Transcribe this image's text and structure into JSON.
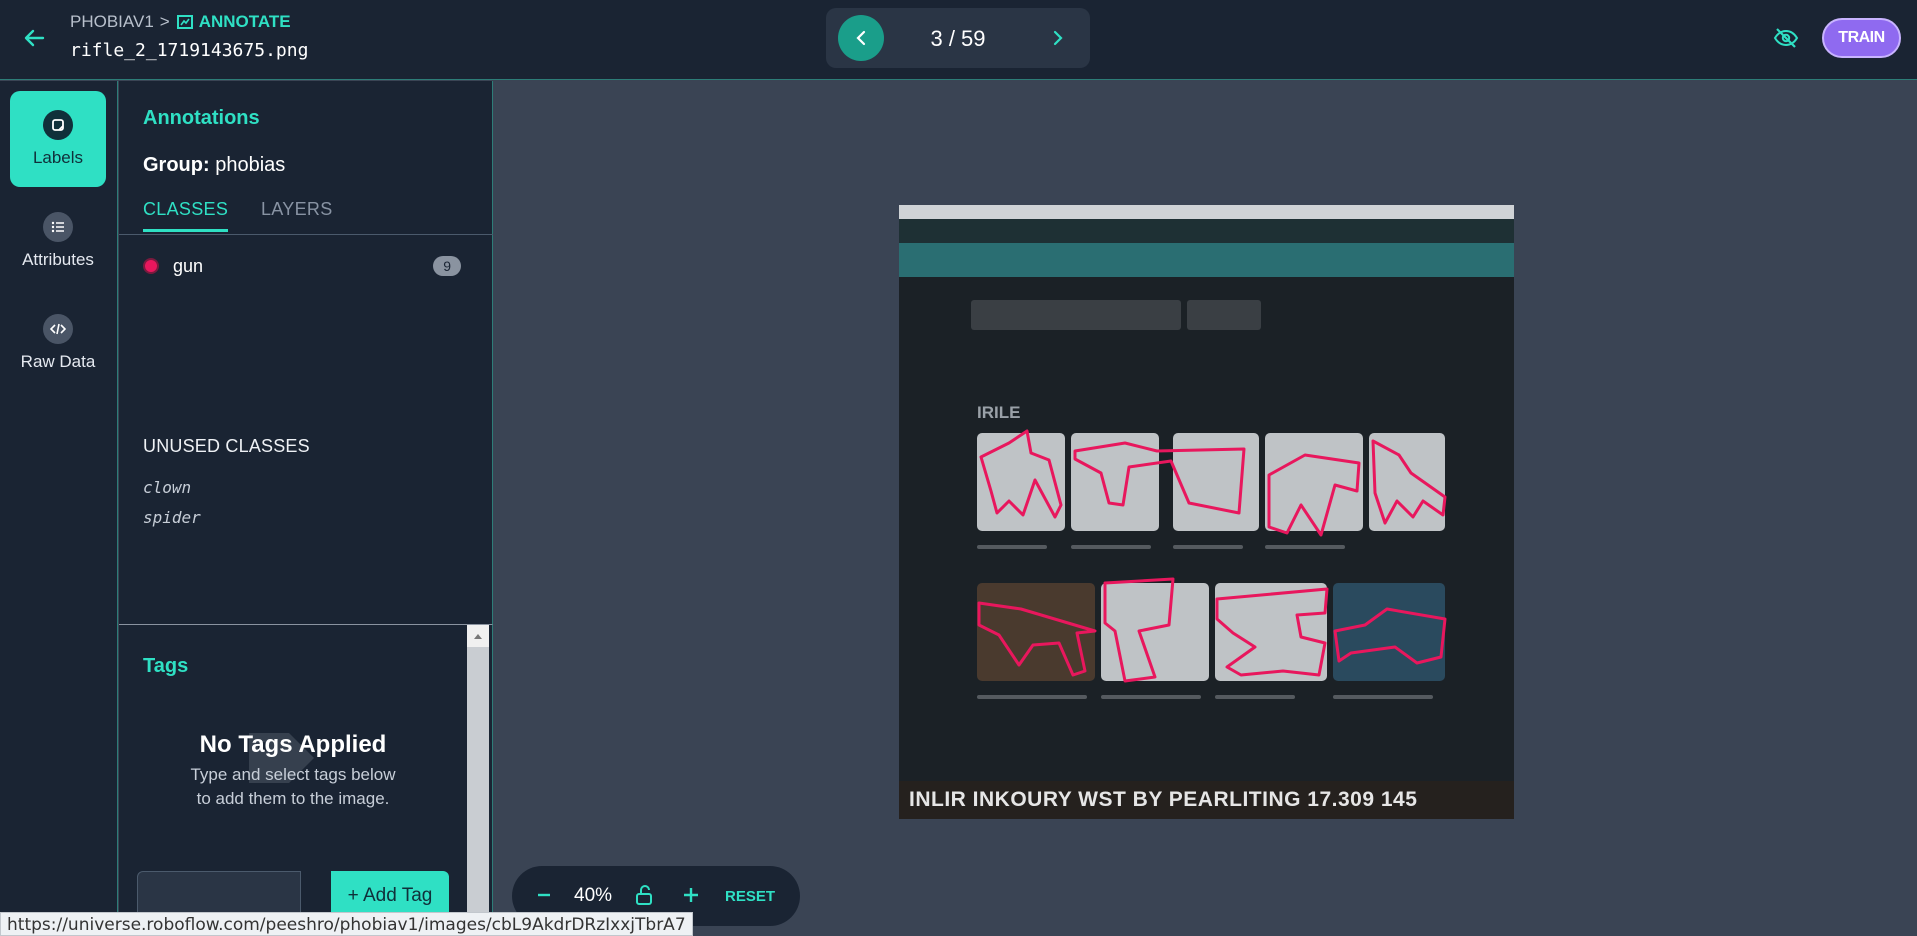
{
  "header": {
    "breadcrumb_project": "PHOBIAV1",
    "breadcrumb_separator": ">",
    "breadcrumb_section": "ANNOTATE",
    "filename": "rifle_2_1719143675.png",
    "pager": {
      "current_label": "3 / 59"
    },
    "train_label": "TRAIN"
  },
  "rail": {
    "items": [
      {
        "label": "Labels",
        "icon": "label-icon",
        "active": true
      },
      {
        "label": "Attributes",
        "icon": "list-icon",
        "active": false
      },
      {
        "label": "Raw Data",
        "icon": "code-icon",
        "active": false
      }
    ]
  },
  "annotations": {
    "title": "Annotations",
    "group_label": "Group:",
    "group_value": "phobias",
    "tabs": [
      "CLASSES",
      "LAYERS"
    ],
    "classes": [
      {
        "name": "gun",
        "count": "9",
        "color": "#e8175d"
      }
    ],
    "unused_title": "UNUSED CLASSES",
    "unused": [
      "clown",
      "spider"
    ]
  },
  "tags": {
    "title": "Tags",
    "empty_title": "No Tags Applied",
    "empty_sub_1": "Type and select tags below",
    "empty_sub_2": "to add them to the image.",
    "add_label": "+ Add Tag"
  },
  "zoom": {
    "minus": "−",
    "percent": "40%",
    "plus": "+",
    "reset": "RESET"
  },
  "status_url": "https://universe.roboflow.com/peeshro/phobiav1/images/cbL9AkdrDRzIxxjTbrA7",
  "canvas": {
    "heading": "IRILE",
    "bottom_text": "INLIR INKOURY WST BY PEARLITING 17.309   145"
  },
  "colors": {
    "accent": "#2fe0c4",
    "annotation": "#e8175d",
    "train": "#8f6af0"
  }
}
